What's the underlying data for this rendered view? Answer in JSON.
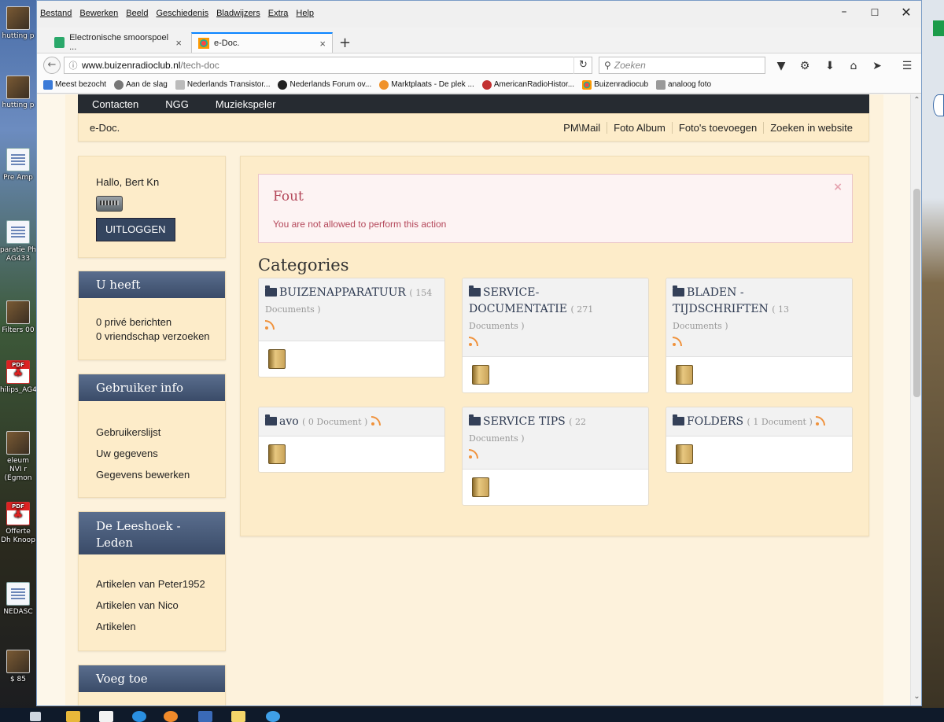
{
  "desktop": {
    "icons": [
      "hutting p",
      "hutting p",
      "Pre Amp",
      "paratie Ph AG433",
      "Filters 00",
      "hilips_AG4",
      "eleum NVI r (Egmon",
      "Offerte Dh Knoop",
      "NEDASC",
      "$ 85"
    ]
  },
  "browser": {
    "menu": [
      "Bestand",
      "Bewerken",
      "Beeld",
      "Geschiedenis",
      "Bladwijzers",
      "Extra",
      "Help"
    ],
    "tabs": [
      {
        "label": "Electronische smoorspoel ...",
        "close": "×"
      },
      {
        "label": "e-Doc.",
        "close": "×"
      }
    ],
    "new_tab": "+",
    "url_host": "www.buizenradioclub.nl",
    "url_path": "/tech-doc",
    "search_placeholder": "Zoeken",
    "bookmarks": [
      "Meest bezocht",
      "Aan de slag",
      "Nederlands Transistor...",
      "Nederlands Forum ov...",
      "Marktplaats - De plek ...",
      "AmericanRadioHistor...",
      "Buizenradiocub",
      "analoog foto"
    ]
  },
  "site": {
    "topnav": [
      "Contacten",
      "NGG",
      "Muziekspeler"
    ],
    "brand": "e-Doc.",
    "links": [
      "PM\\Mail",
      "Foto Album",
      "Foto's toevoegen",
      "Zoeken in website"
    ]
  },
  "sidebar": {
    "greeting": "Hallo, Bert Kn",
    "logout": "UITLOGGEN",
    "u_heeft": {
      "title": "U heeft",
      "items": [
        "0 privé berichten",
        "0 vriendschap verzoeken"
      ]
    },
    "gebruiker_info": {
      "title": "Gebruiker info",
      "items": [
        "Gebruikerslijst",
        "Uw gegevens",
        "Gegevens bewerken"
      ]
    },
    "leeshoek": {
      "title": "De Leeshoek - Leden",
      "items": [
        "Artikelen van Peter1952",
        "Artikelen van Nico",
        "Artikelen"
      ]
    },
    "voeg_toe": {
      "title": "Voeg toe"
    }
  },
  "main": {
    "alert": {
      "title": "Fout",
      "message": "You are not allowed to perform this action",
      "close": "×"
    },
    "categories_title": "Categories",
    "categories": [
      {
        "name": "BUIZENAPPARATUUR",
        "count_a": "( 154",
        "count_b": "Documents )"
      },
      {
        "name_a": "SERVICE-",
        "name_b": "DOCUMENTATIE",
        "count_a": "( 271",
        "count_b": "Documents )"
      },
      {
        "name_a": "BLADEN -",
        "name_b": "TIJDSCHRIFTEN",
        "count_a": "( 13",
        "count_b": "Documents )"
      },
      {
        "name": "avo",
        "count": "( 0 Document )"
      },
      {
        "name": "SERVICE TIPS",
        "count_a": "( 22",
        "count_b": "Documents )"
      },
      {
        "name": "FOLDERS",
        "count": "( 1 Document )"
      }
    ]
  }
}
